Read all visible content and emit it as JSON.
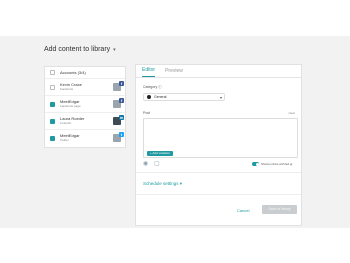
{
  "header": {
    "title": "Add content to library",
    "chevron_icon": "chevron-down-icon"
  },
  "accounts": {
    "header_label": "Accounts (3/4)",
    "items": [
      {
        "name": "Kevin Crace",
        "sub": "Facebook",
        "checked": false,
        "network_icon": "facebook-icon"
      },
      {
        "name": "MeetEdgar",
        "sub": "Facebook page",
        "checked": true,
        "network_icon": "facebook-icon"
      },
      {
        "name": "Laura Roeder",
        "sub": "LinkedIn",
        "checked": true,
        "network_icon": "linkedin-icon"
      },
      {
        "name": "MeetEdgar",
        "sub": "Twitter",
        "checked": true,
        "network_icon": "twitter-icon"
      }
    ]
  },
  "editor": {
    "tabs": [
      {
        "label": "Editor",
        "active": true
      },
      {
        "label": "Preview",
        "active": false
      }
    ],
    "category_label": "Category ⓘ",
    "category_value": "General",
    "post_label": "Post",
    "clear_label": "clear",
    "add_variation_label": "+ Add variation",
    "toggle_label": "Shorten links with Ed.gr",
    "schedule_label": "Schedule settings ▾",
    "cancel_label": "Cancel",
    "save_label": "Save to library"
  },
  "colors": {
    "accent": "#1e9aa0",
    "panel_bg": "#f2f2f2",
    "button_disabled": "#c9cdd0"
  }
}
